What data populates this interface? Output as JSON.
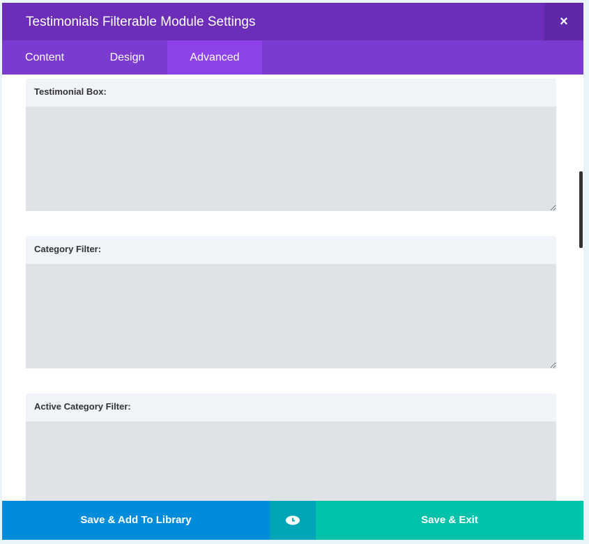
{
  "header": {
    "title": "Testimonials Filterable Module Settings",
    "close_label": "×"
  },
  "tabs": [
    {
      "label": "Content"
    },
    {
      "label": "Design"
    },
    {
      "label": "Advanced"
    }
  ],
  "sections": [
    {
      "label": "Testimonial Box:",
      "value": ""
    },
    {
      "label": "Category Filter:",
      "value": ""
    },
    {
      "label": "Active Category Filter:",
      "value": ""
    }
  ],
  "footer": {
    "save_library": "Save & Add To Library",
    "preview_icon": "eye-icon",
    "save_exit": "Save & Exit"
  },
  "colors": {
    "header": "#6c2eb9",
    "tabs": "#7b3bd0",
    "active_tab": "#8e42ea",
    "save_library": "#008bdb",
    "preview": "#00a5b7",
    "save_exit": "#00c1aa"
  }
}
